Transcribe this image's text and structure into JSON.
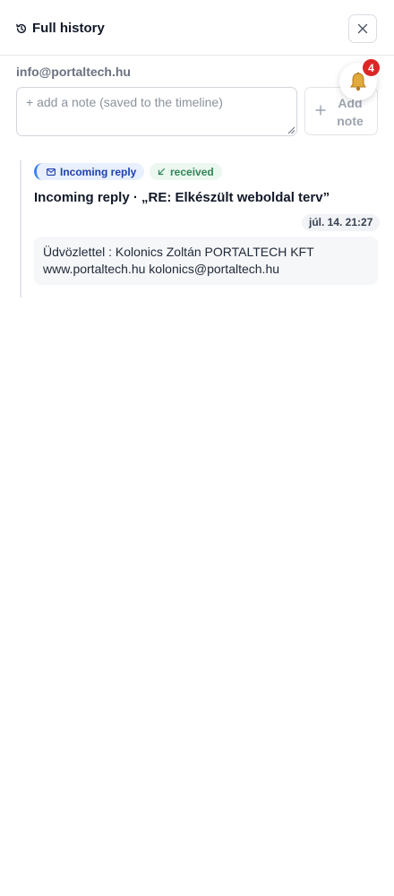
{
  "header": {
    "title": "Full history",
    "icon": "history-icon",
    "close_icon": "close-icon"
  },
  "contact": {
    "email": "info@portaltech.hu"
  },
  "note": {
    "placeholder": "+ add a note (saved to the timeline)",
    "value": "",
    "add_button_label": "Add note",
    "add_button_icon": "plus-icon"
  },
  "notifications": {
    "icon": "bell-icon",
    "count": "4",
    "badge_color": "#dc2626"
  },
  "timeline": {
    "entries": [
      {
        "type_label": "Incoming reply",
        "type_icon": "mail-icon",
        "status_label": "received",
        "status_icon": "arrow-down-left-icon",
        "title": "Incoming reply · „RE: Elkészült weboldal terv”",
        "timestamp": "júl. 14. 21:27",
        "body": "Üdvözlettel : Kolonics Zoltán PORTALTECH KFT www.portaltech.hu kolonics@portaltech.hu"
      }
    ]
  },
  "colors": {
    "incoming_accent": "#3b82f6",
    "incoming_text": "#1e40af",
    "received_text": "#2f855a",
    "divider": "#e5e7eb"
  }
}
